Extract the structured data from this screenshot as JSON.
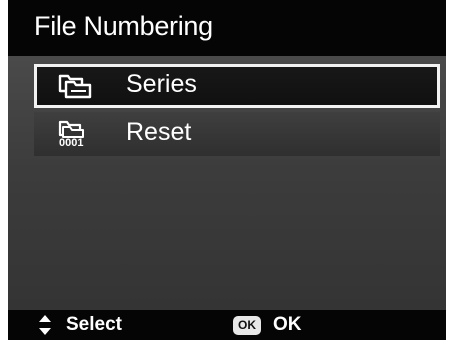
{
  "header": {
    "title": "File Numbering"
  },
  "menu": {
    "items": [
      {
        "label": "Series",
        "icon": "series-folder-icon",
        "selected": true
      },
      {
        "label": "Reset",
        "icon": "reset-folder-0001-icon",
        "icon_text": "0001",
        "selected": false
      }
    ]
  },
  "footer": {
    "select_label": "Select",
    "ok_badge": "OK",
    "ok_label": "OK"
  },
  "colors": {
    "background": "#3a3a3a",
    "bars": "#050505",
    "selection_border": "#f2f2f2",
    "text": "#ffffff"
  }
}
